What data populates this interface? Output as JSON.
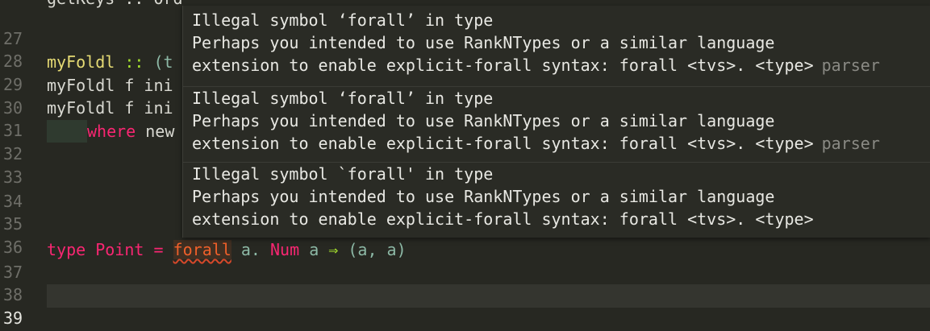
{
  "editor": {
    "top_partial_code": "getKeys :: Ord",
    "lines": [
      {
        "number": "27"
      },
      {
        "number": "28"
      },
      {
        "number": "29"
      },
      {
        "number": "30"
      },
      {
        "number": "31"
      },
      {
        "number": "32"
      },
      {
        "number": "33"
      },
      {
        "number": "34"
      },
      {
        "number": "35"
      },
      {
        "number": "36"
      },
      {
        "number": "37"
      },
      {
        "number": "38"
      },
      {
        "number": "39"
      }
    ],
    "code": {
      "l29_name": "myFoldl",
      "l29_op": "::",
      "l29_rest": "(t",
      "l30_text": "myFoldl f ini",
      "l31_text": "myFoldl f ini",
      "l32_kw": "where",
      "l32_rest": "new",
      "l37_type": "type",
      "l37_name": "Point",
      "l37_eq": "=",
      "l37_forall": "forall",
      "l37_a1": "a.",
      "l37_num": "Num",
      "l37_a2": "a",
      "l37_arrow": "⇒",
      "l37_tuple": "(a, a)"
    }
  },
  "tooltip": {
    "diagnostics": [
      {
        "line1": "Illegal symbol ‘forall’ in type",
        "line2": "Perhaps you intended to use RankNTypes or a similar language",
        "line3": "extension to enable explicit-forall syntax: forall <tvs>. <type>",
        "source": "parser"
      },
      {
        "line1": "Illegal symbol ‘forall’ in type",
        "line2": "Perhaps you intended to use RankNTypes or a similar language",
        "line3": "extension to enable explicit-forall syntax: forall <tvs>. <type>",
        "source": "parser"
      },
      {
        "line1": "Illegal symbol `forall' in type",
        "line2": "Perhaps you intended to use RankNTypes or a similar language",
        "line3": "extension to enable explicit-forall syntax: forall <tvs>. <type>",
        "source": ""
      }
    ]
  },
  "colors": {
    "background": "#272822",
    "keyword": "#f92672",
    "function": "#e6db74",
    "error_underline": "#d6482a"
  }
}
